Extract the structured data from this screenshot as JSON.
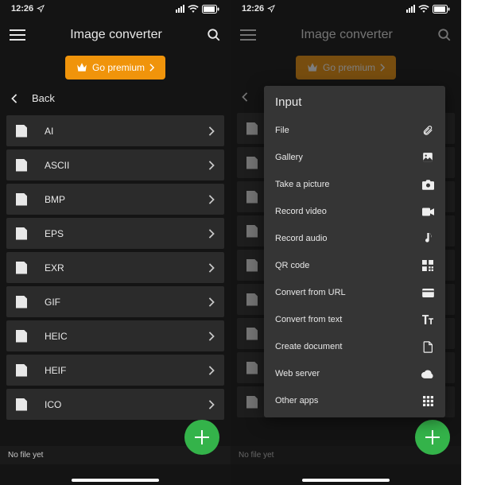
{
  "status": {
    "time": "12:26"
  },
  "header": {
    "title": "Image converter"
  },
  "premium": {
    "label": "Go premium"
  },
  "back": {
    "label": "Back"
  },
  "formats": [
    {
      "label": "AI"
    },
    {
      "label": "ASCII"
    },
    {
      "label": "BMP"
    },
    {
      "label": "EPS"
    },
    {
      "label": "EXR"
    },
    {
      "label": "GIF"
    },
    {
      "label": "HEIC"
    },
    {
      "label": "HEIF"
    },
    {
      "label": "ICO"
    }
  ],
  "nofile": {
    "label": "No file yet"
  },
  "sheet": {
    "title": "Input",
    "items": [
      {
        "label": "File",
        "icon": "paperclip"
      },
      {
        "label": "Gallery",
        "icon": "image"
      },
      {
        "label": "Take a picture",
        "icon": "camera"
      },
      {
        "label": "Record video",
        "icon": "video"
      },
      {
        "label": "Record audio",
        "icon": "note"
      },
      {
        "label": "QR code",
        "icon": "qr"
      },
      {
        "label": "Convert from URL",
        "icon": "card"
      },
      {
        "label": "Convert from text",
        "icon": "text"
      },
      {
        "label": "Create document",
        "icon": "doc"
      },
      {
        "label": "Web server",
        "icon": "cloud"
      },
      {
        "label": "Other apps",
        "icon": "grid"
      }
    ]
  }
}
